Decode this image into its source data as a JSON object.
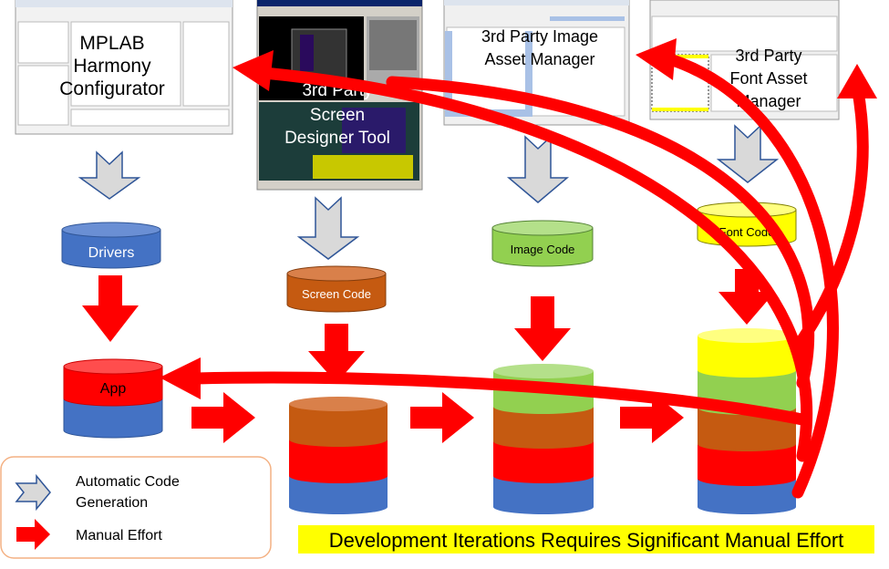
{
  "tools": [
    {
      "id": "mplab",
      "lines": [
        "MPLAB",
        "Harmony",
        "Configurator"
      ]
    },
    {
      "id": "screen",
      "lines": [
        "3rd Party",
        "Screen",
        "Designer Tool"
      ]
    },
    {
      "id": "image",
      "lines": [
        "3rd Party Image",
        "Asset Manager"
      ]
    },
    {
      "id": "font",
      "lines": [
        "3rd Party",
        "Font Asset",
        "Manager"
      ]
    }
  ],
  "code_blocks": {
    "drivers": "Drivers",
    "screen": "Screen Code",
    "image": "Image Code",
    "font": "Font Code",
    "app": "App"
  },
  "legend": {
    "auto": "Automatic Code Generation",
    "auto_l1": "Automatic Code",
    "auto_l2": "Generation",
    "manual": "Manual Effort"
  },
  "caption": "Development Iterations Requires Significant Manual Effort",
  "colors": {
    "driver_blue": "#4472C4",
    "screen_orange": "#C55A11",
    "image_green": "#92D050",
    "font_yellow": "#FFFF00",
    "app_red": "#FF0000",
    "auto_arrow": "#D9D9D9",
    "auto_arrow_border": "#2F5597",
    "caption_highlight": "#FFFF00",
    "legend_border": "#F4B183"
  }
}
